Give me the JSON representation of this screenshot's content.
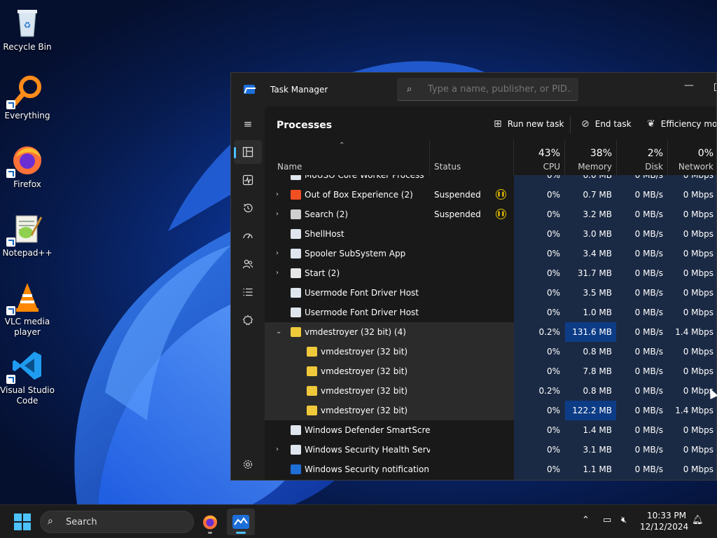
{
  "desktop": {
    "icons": [
      {
        "label": "Recycle Bin",
        "icon": "recycle-bin-icon"
      },
      {
        "label": "Everything",
        "icon": "everything-search-icon"
      },
      {
        "label": "Firefox",
        "icon": "firefox-icon"
      },
      {
        "label": "Notepad++",
        "icon": "notepad-plus-plus-icon"
      },
      {
        "label": "VLC media player",
        "icon": "vlc-icon"
      },
      {
        "label": "Visual Studio Code",
        "icon": "vscode-icon"
      }
    ]
  },
  "window": {
    "title": "Task Manager",
    "search_placeholder": "Type a name, publisher, or PID...",
    "minimize": "—"
  },
  "nav": {
    "items": [
      "menu-icon",
      "processes-icon",
      "performance-icon",
      "app-history-icon",
      "startup-apps-icon",
      "users-icon",
      "details-icon",
      "services-icon",
      "settings-icon"
    ]
  },
  "toolbar": {
    "page_title": "Processes",
    "run_new_task": "Run new task",
    "end_task": "End task",
    "efficiency_mode": "Efficiency mod"
  },
  "columns": {
    "name": "Name",
    "status": "Status",
    "cpu_pct": "43%",
    "cpu": "CPU",
    "mem_pct": "38%",
    "mem": "Memory",
    "disk_pct": "2%",
    "disk": "Disk",
    "net_pct": "0%",
    "net": "Network"
  },
  "rows": [
    {
      "name": "MoUSO Core Worker Process",
      "status": "",
      "cpu": "0%",
      "mem": "6.0 MB",
      "disk": "0 MB/s",
      "net": "0 Mbps",
      "expand": "",
      "indent": 0,
      "icon": "generic"
    },
    {
      "name": "Out of Box Experience (2)",
      "status": "Suspended",
      "cpu": "0%",
      "mem": "0.7 MB",
      "disk": "0 MB/s",
      "net": "0 Mbps",
      "expand": "›",
      "indent": 0,
      "icon": "ms"
    },
    {
      "name": "Search (2)",
      "status": "Suspended",
      "cpu": "0%",
      "mem": "3.2 MB",
      "disk": "0 MB/s",
      "net": "0 Mbps",
      "expand": "›",
      "indent": 0,
      "icon": "search"
    },
    {
      "name": "ShellHost",
      "status": "",
      "cpu": "0%",
      "mem": "3.0 MB",
      "disk": "0 MB/s",
      "net": "0 Mbps",
      "expand": "",
      "indent": 0,
      "icon": "generic"
    },
    {
      "name": "Spooler SubSystem App",
      "status": "",
      "cpu": "0%",
      "mem": "3.4 MB",
      "disk": "0 MB/s",
      "net": "0 Mbps",
      "expand": "›",
      "indent": 0,
      "icon": "generic"
    },
    {
      "name": "Start (2)",
      "status": "",
      "cpu": "0%",
      "mem": "31.7 MB",
      "disk": "0 MB/s",
      "net": "0 Mbps",
      "expand": "›",
      "indent": 0,
      "icon": "start"
    },
    {
      "name": "Usermode Font Driver Host",
      "status": "",
      "cpu": "0%",
      "mem": "3.5 MB",
      "disk": "0 MB/s",
      "net": "0 Mbps",
      "expand": "",
      "indent": 0,
      "icon": "generic"
    },
    {
      "name": "Usermode Font Driver Host",
      "status": "",
      "cpu": "0%",
      "mem": "1.0 MB",
      "disk": "0 MB/s",
      "net": "0 Mbps",
      "expand": "",
      "indent": 0,
      "icon": "generic"
    },
    {
      "name": "vmdestroyer (32 bit) (4)",
      "status": "",
      "cpu": "0.2%",
      "mem": "131.6 MB",
      "disk": "0 MB/s",
      "net": "1.4 Mbps",
      "expand": "⌄",
      "indent": 0,
      "icon": "vm"
    },
    {
      "name": "vmdestroyer (32 bit)",
      "status": "",
      "cpu": "0%",
      "mem": "0.8 MB",
      "disk": "0 MB/s",
      "net": "0 Mbps",
      "expand": "",
      "indent": 1,
      "icon": "vm"
    },
    {
      "name": "vmdestroyer (32 bit)",
      "status": "",
      "cpu": "0%",
      "mem": "7.8 MB",
      "disk": "0 MB/s",
      "net": "0 Mbps",
      "expand": "",
      "indent": 1,
      "icon": "vm"
    },
    {
      "name": "vmdestroyer (32 bit)",
      "status": "",
      "cpu": "0.2%",
      "mem": "0.8 MB",
      "disk": "0 MB/s",
      "net": "0 Mbps",
      "expand": "",
      "indent": 1,
      "icon": "vm"
    },
    {
      "name": "vmdestroyer (32 bit)",
      "status": "",
      "cpu": "0%",
      "mem": "122.2 MB",
      "disk": "0 MB/s",
      "net": "1.4 Mbps",
      "expand": "",
      "indent": 1,
      "icon": "vm"
    },
    {
      "name": "Windows Defender SmartScreen",
      "status": "",
      "cpu": "0%",
      "mem": "1.4 MB",
      "disk": "0 MB/s",
      "net": "0 Mbps",
      "expand": "",
      "indent": 0,
      "icon": "generic"
    },
    {
      "name": "Windows Security Health Servi...",
      "status": "",
      "cpu": "0%",
      "mem": "3.1 MB",
      "disk": "0 MB/s",
      "net": "0 Mbps",
      "expand": "›",
      "indent": 0,
      "icon": "generic"
    },
    {
      "name": "Windows Security notification...",
      "status": "",
      "cpu": "0%",
      "mem": "1.1 MB",
      "disk": "0 MB/s",
      "net": "0 Mbps",
      "expand": "",
      "indent": 0,
      "icon": "shield"
    }
  ],
  "taskbar": {
    "search_label": "Search",
    "time": "10:33 PM",
    "date": "12/12/2024"
  },
  "colors": {
    "accent": "#4cc2ff",
    "heat_light": "#1b2a44",
    "heat_strong": "#0d3c87",
    "suspended_icon": "#e6c300"
  }
}
